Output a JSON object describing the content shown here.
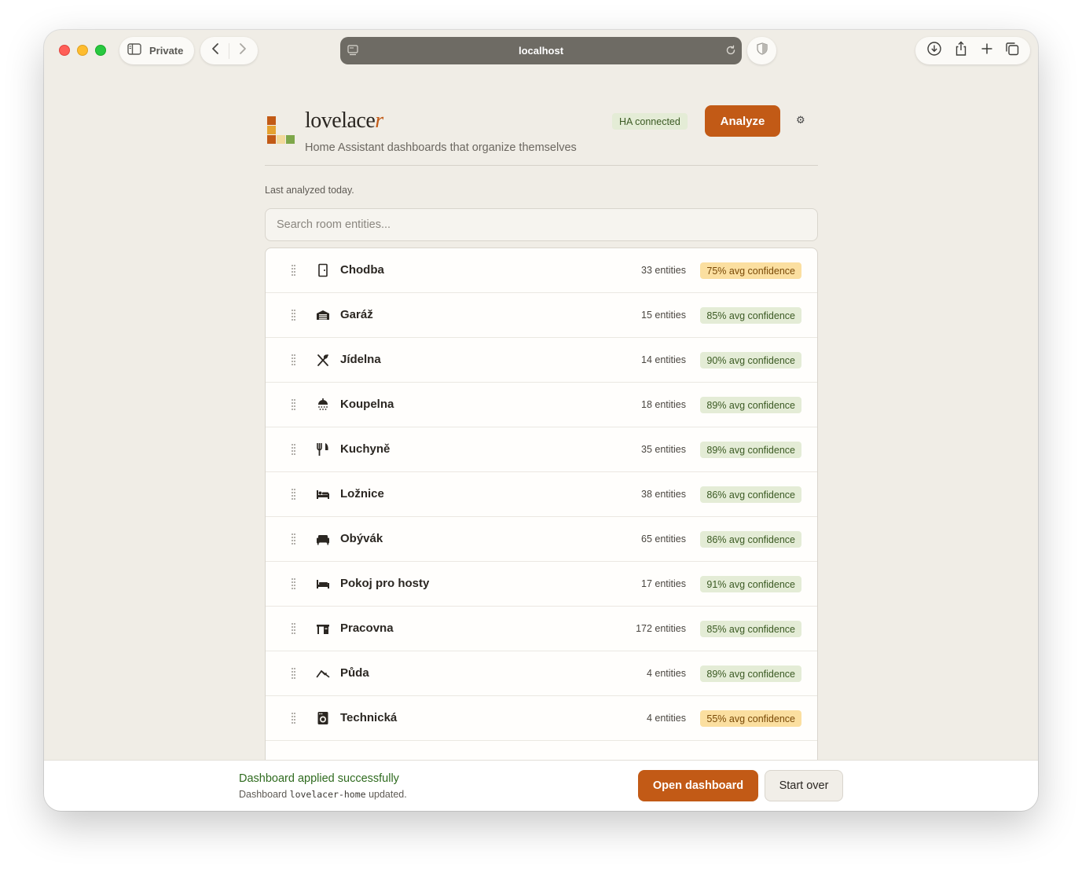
{
  "browser": {
    "private_label": "Private",
    "url": "localhost"
  },
  "app": {
    "brand_prefix": "lovelace",
    "brand_suffix": "r",
    "tagline": "Home Assistant dashboards that organize themselves",
    "ha_status": "HA connected",
    "analyze_label": "Analyze",
    "settings_glyph": "⚙"
  },
  "last_analyzed": "Last analyzed today.",
  "search": {
    "placeholder": "Search room entities..."
  },
  "rooms": [
    {
      "name": "Chodba",
      "entities": "33 entities",
      "confidence": "75% avg confidence",
      "level": "mid",
      "icon": "door-icon"
    },
    {
      "name": "Garáž",
      "entities": "15 entities",
      "confidence": "85% avg confidence",
      "level": "good",
      "icon": "garage-icon"
    },
    {
      "name": "Jídelna",
      "entities": "14 entities",
      "confidence": "90% avg confidence",
      "level": "good",
      "icon": "silverware-icon"
    },
    {
      "name": "Koupelna",
      "entities": "18 entities",
      "confidence": "89% avg confidence",
      "level": "good",
      "icon": "shower-icon"
    },
    {
      "name": "Kuchyně",
      "entities": "35 entities",
      "confidence": "89% avg confidence",
      "level": "good",
      "icon": "fork-knife-icon"
    },
    {
      "name": "Ložnice",
      "entities": "38 entities",
      "confidence": "86% avg confidence",
      "level": "good",
      "icon": "bed-icon"
    },
    {
      "name": "Obývák",
      "entities": "65 entities",
      "confidence": "86% avg confidence",
      "level": "good",
      "icon": "sofa-icon"
    },
    {
      "name": "Pokoj pro hosty",
      "entities": "17 entities",
      "confidence": "91% avg confidence",
      "level": "good",
      "icon": "guest-bed-icon"
    },
    {
      "name": "Pracovna",
      "entities": "172 entities",
      "confidence": "85% avg confidence",
      "level": "good",
      "icon": "desk-icon"
    },
    {
      "name": "Půda",
      "entities": "4 entities",
      "confidence": "89% avg confidence",
      "level": "good",
      "icon": "roof-icon"
    },
    {
      "name": "Technická",
      "entities": "4 entities",
      "confidence": "55% avg confidence",
      "level": "mid",
      "icon": "washer-icon"
    }
  ],
  "banner": {
    "title": "Dashboard applied successfully",
    "sub_prefix": "Dashboard",
    "dashboard_id": "lovelacer-home",
    "sub_suffix": "updated.",
    "open_label": "Open dashboard",
    "start_over_label": "Start over"
  },
  "colors": {
    "accent": "#c25a16",
    "good_badge": "#e4ecd6",
    "mid_badge": "#fbdfa0",
    "success_text": "#2f6b1f"
  }
}
